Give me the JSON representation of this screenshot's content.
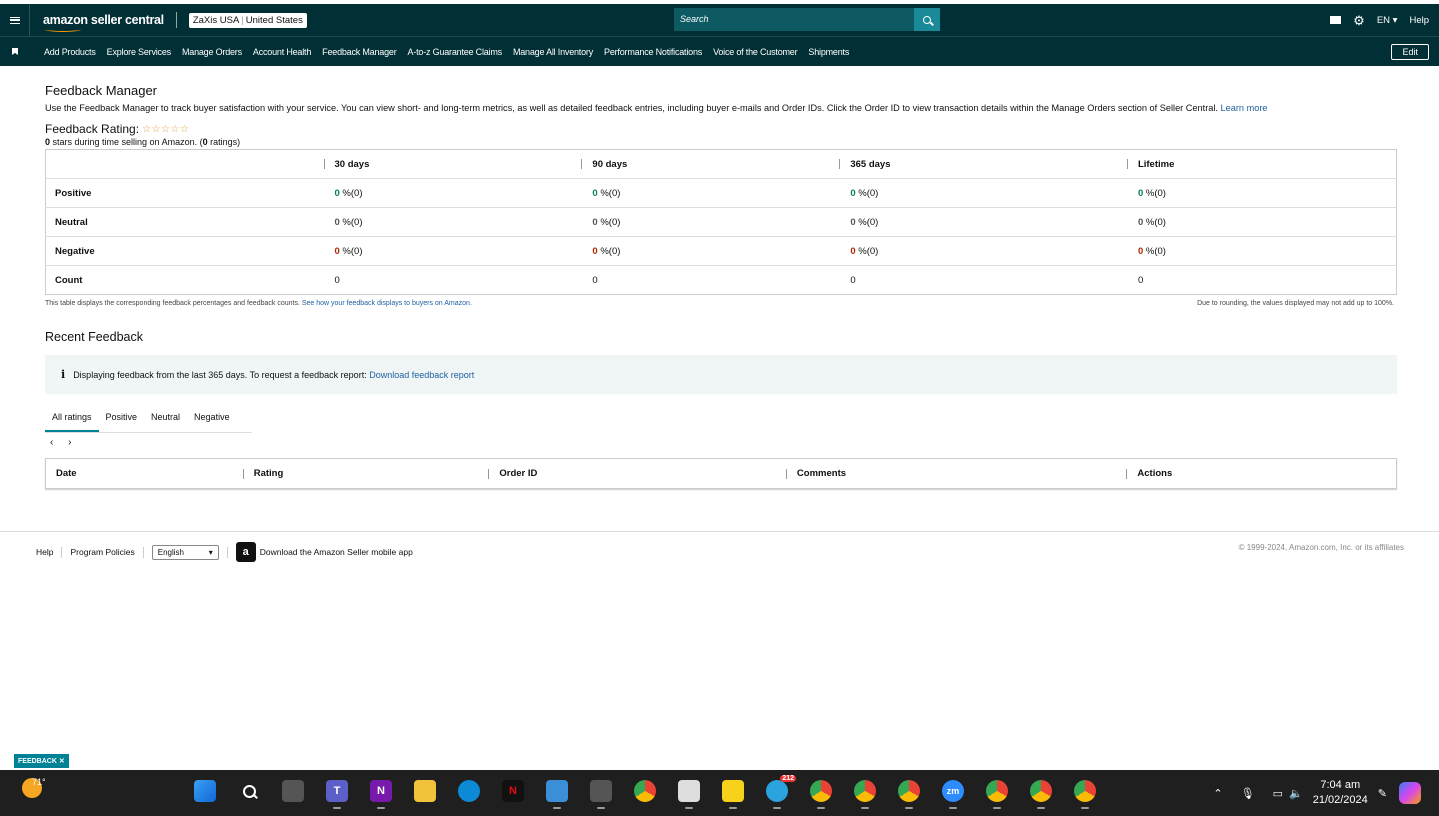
{
  "header": {
    "logo": "amazon seller central",
    "store": "ZaXis USA",
    "marketplace": "United States",
    "search_placeholder": "Search",
    "language": "EN",
    "help": "Help"
  },
  "nav": {
    "items": [
      "Add Products",
      "Explore Services",
      "Manage Orders",
      "Account Health",
      "Feedback Manager",
      "A-to-z Guarantee Claims",
      "Manage All Inventory",
      "Performance Notifications",
      "Voice of the Customer",
      "Shipments"
    ],
    "edit": "Edit"
  },
  "page": {
    "title": "Feedback Manager",
    "description": "Use the Feedback Manager to track buyer satisfaction with your service. You can view short- and long-term metrics, as well as detailed feedback entries, including buyer e-mails and Order IDs. Click the Order ID to view transaction details within the Manage Orders section of Seller Central.",
    "learn_more": "Learn more",
    "rating_label": "Feedback Rating:",
    "stars": "☆☆☆☆☆",
    "stars_count": "0",
    "rating_text_a": " stars during time selling on Amazon. (",
    "ratings_count": "0",
    "rating_text_b": " ratings)"
  },
  "table": {
    "columns": [
      "30 days",
      "90 days",
      "365 days",
      "Lifetime"
    ],
    "rows": [
      {
        "label": "Positive",
        "values": [
          "0",
          "0",
          "0",
          "0"
        ],
        "suffix": " %(0)"
      },
      {
        "label": "Neutral",
        "values": [
          "0",
          "0",
          "0",
          "0"
        ],
        "suffix": " %(0)"
      },
      {
        "label": "Negative",
        "values": [
          "0",
          "0",
          "0",
          "0"
        ],
        "suffix": " %(0)"
      },
      {
        "label": "Count",
        "values": [
          "0",
          "0",
          "0",
          "0"
        ],
        "suffix": ""
      }
    ],
    "note_left": "This table displays the corresponding feedback percentages and feedback counts.",
    "note_link": "See how your feedback displays to buyers on Amazon.",
    "note_right": "Due to rounding, the values displayed may not add up to 100%."
  },
  "recent": {
    "title": "Recent Feedback",
    "alert": "Displaying feedback from the last 365 days. To request a feedback report:",
    "alert_link": "Download feedback report",
    "tabs": [
      "All ratings",
      "Positive",
      "Neutral",
      "Negative"
    ],
    "pager": "‹ ›",
    "columns": [
      "Date",
      "Rating",
      "Order ID",
      "Comments",
      "Actions"
    ]
  },
  "footer": {
    "help": "Help",
    "policies": "Program Policies",
    "language": "English",
    "app": "Download the Amazon Seller mobile app",
    "copyright": "© 1999-2024, Amazon.com, Inc. or its affiliates"
  },
  "feedback_tab": "FEEDBACK ✕",
  "taskbar": {
    "temp": "71°",
    "time": "7:04 am",
    "date": "21/02/2024",
    "badge": "212"
  }
}
